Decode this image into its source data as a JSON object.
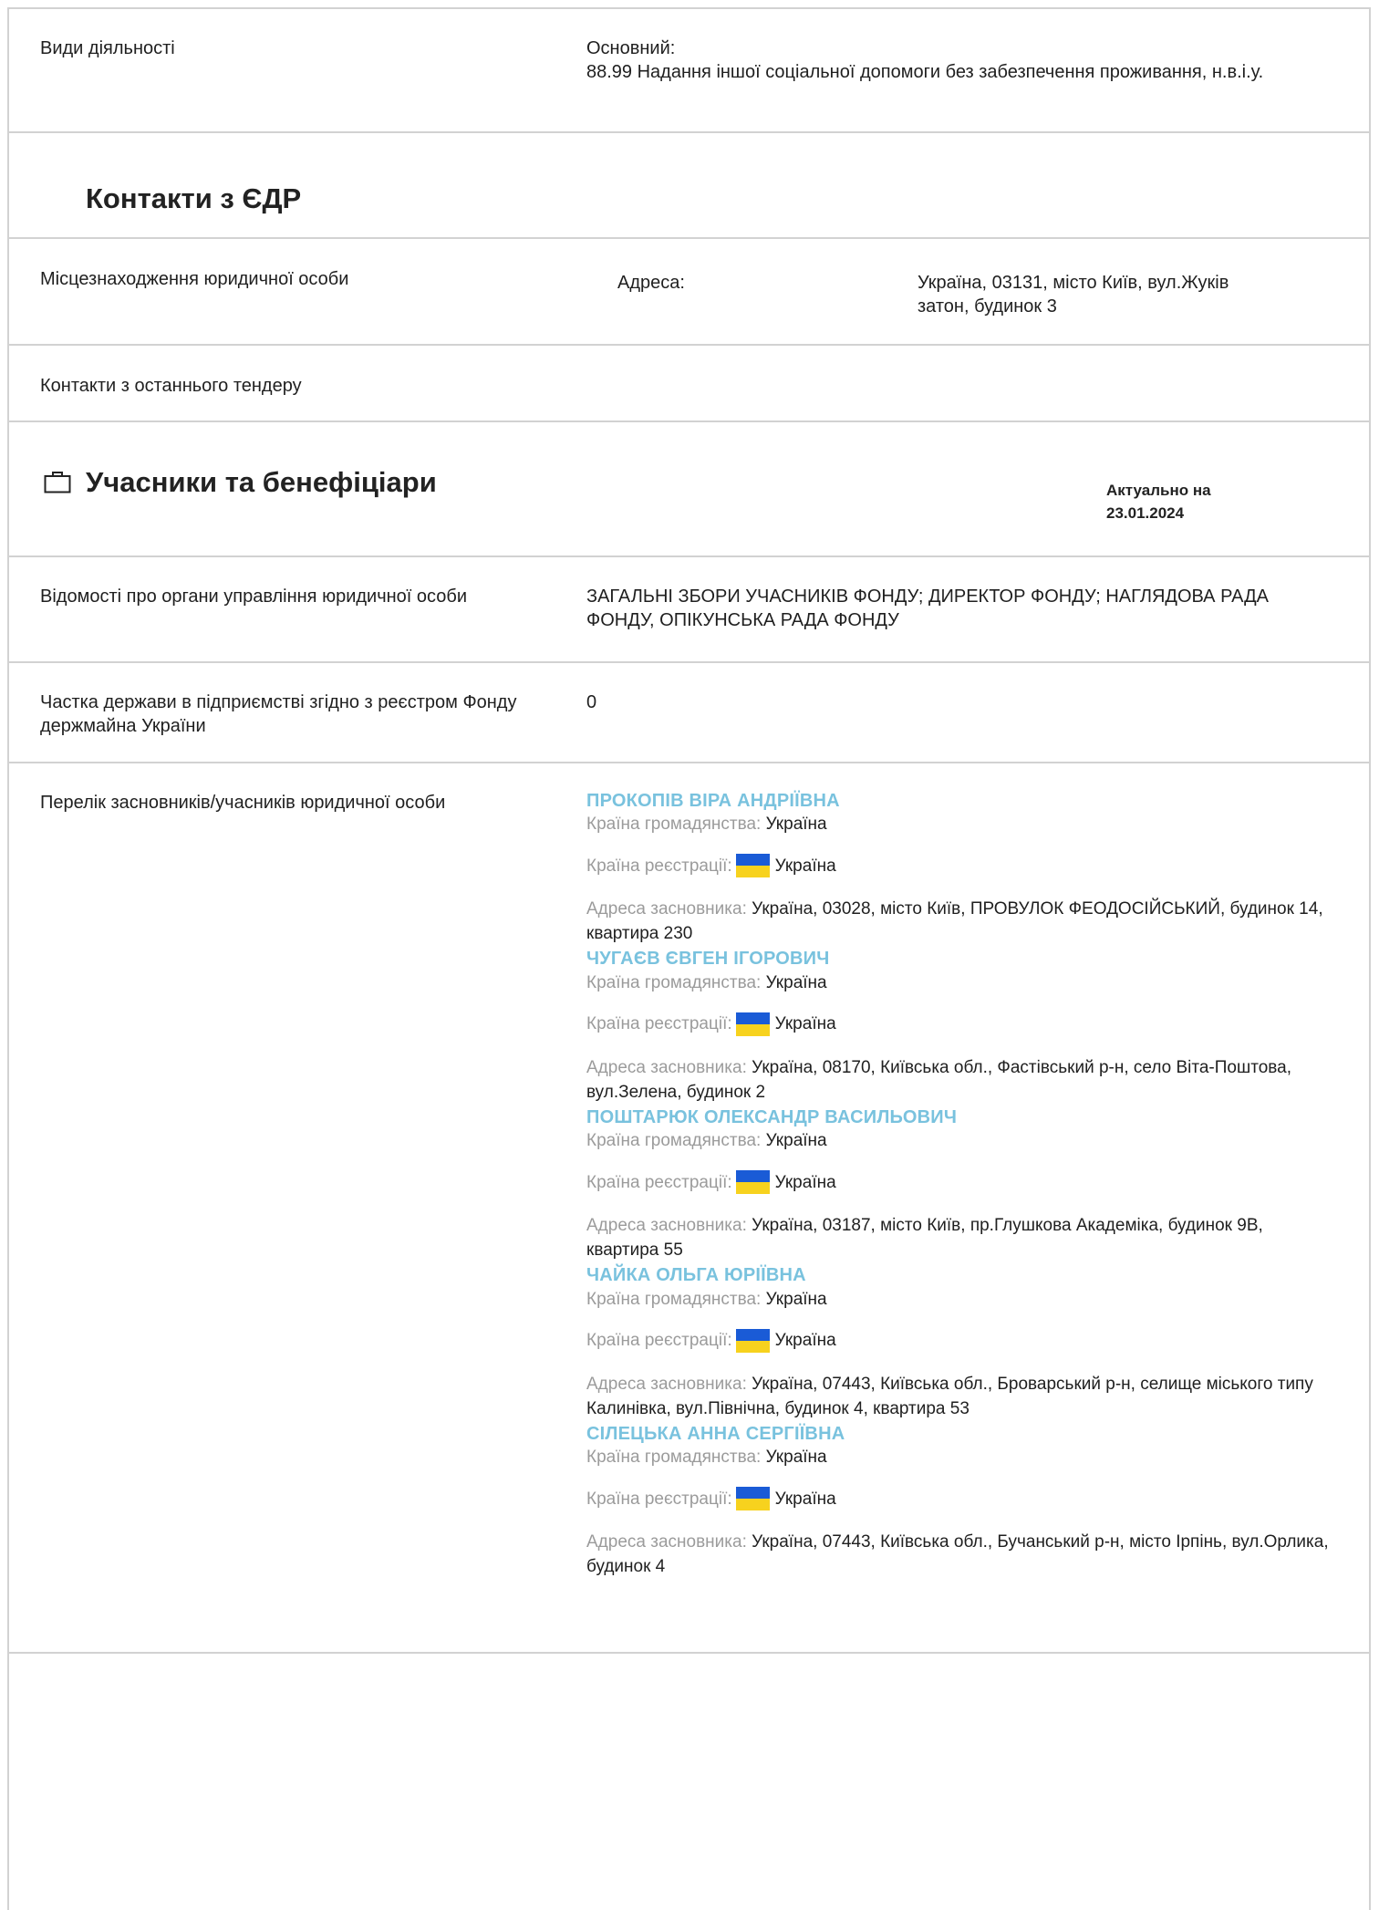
{
  "activity": {
    "label": "Види діяльності",
    "main_label": "Основний:",
    "main_value": "88.99 Надання іншої соціальної допомоги без забезпечення проживання, н.в.і.у."
  },
  "contacts_edr": {
    "title": "Контакти з ЄДР",
    "location_label": "Місцезнаходження юридичної особи",
    "address_label": "Адреса:",
    "address_value": "Україна, 03131, місто Київ, вул.Жуків затон, будинок 3",
    "tender_label": "Контакти з останнього тендеру"
  },
  "participants": {
    "title": "Учасники та бенефіціари",
    "icon": "briefcase-icon",
    "as_of_label": "Актуально на",
    "as_of_date": "23.01.2024",
    "governance_label": "Відомості про органи управління юридичної особи",
    "governance_value": "ЗАГАЛЬНІ ЗБОРИ УЧАСНИКІВ ФОНДУ; ДИРЕКТОР ФОНДУ; НАГЛЯДОВА РАДА ФОНДУ, ОПІКУНСЬКА РАДА ФОНДУ",
    "state_share_label": "Частка держави в підприємстві згідно з реєстром Фонду держмайна України",
    "state_share_value": "0",
    "founders_label": "Перелік засновників/учасників юридичної особи",
    "citizenship_label": "Країна громадянства:",
    "registration_label": "Країна реєстрації:",
    "address_label": "Адреса засновника:",
    "flag_icon": "ukraine-flag-icon",
    "flag_colors": {
      "top": "#1a5bd6",
      "bottom": "#f7d21e"
    },
    "founders": [
      {
        "name": "ПРОКОПІВ ВІРА АНДРІЇВНА",
        "citizenship": "Україна",
        "registration": "Україна",
        "address": "Україна, 03028, місто Київ, ПРОВУЛОК ФЕОДОСІЙСЬКИЙ, будинок 14, квартира 230"
      },
      {
        "name": "ЧУГАЄВ ЄВГЕН ІГОРОВИЧ",
        "citizenship": "Україна",
        "registration": "Україна",
        "address": "Україна, 08170, Київська обл., Фастівський р-н, село Віта-Поштова, вул.Зелена, будинок 2"
      },
      {
        "name": "ПОШТАРЮК ОЛЕКСАНДР ВАСИЛЬОВИЧ",
        "citizenship": "Україна",
        "registration": "Україна",
        "address": "Україна, 03187, місто Київ, пр.Глушкова Академіка, будинок 9В, квартира 55"
      },
      {
        "name": "ЧАЙКА ОЛЬГА ЮРІЇВНА",
        "citizenship": "Україна",
        "registration": "Україна",
        "address": "Україна, 07443, Київська обл., Броварський р-н, селище міського типу Калинівка, вул.Північна, будинок 4, квартира 53"
      },
      {
        "name": "СІЛЕЦЬКА АННА СЕРГІЇВНА",
        "citizenship": "Україна",
        "registration": "Україна",
        "address": "Україна, 07443, Київська обл., Бучанський р-н, місто Ірпінь, вул.Орлика, будинок 4"
      }
    ]
  },
  "colors": {
    "founder_name": "#79c2de",
    "muted_label": "#9b9b9b",
    "border": "#d2d2d2"
  }
}
